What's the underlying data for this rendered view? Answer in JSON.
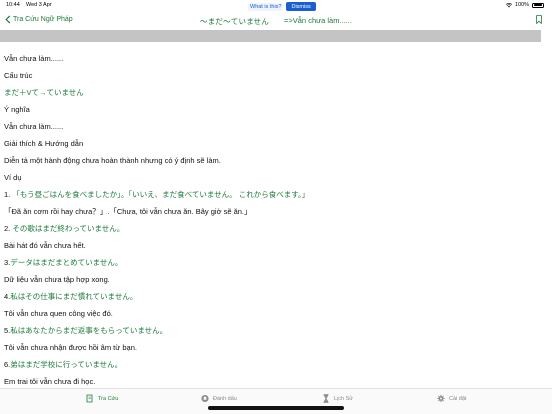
{
  "status": {
    "time": "10:44",
    "date": "Wed 3 Apr",
    "battery": "100%"
  },
  "banner": {
    "question": "What is this?",
    "dismiss": "Dismiss"
  },
  "nav": {
    "back_label": "Tra Cứu Ngữ Pháp",
    "title": "～まだ～ていません",
    "subtitle": "=>Vẫn chưa làm......",
    "accent_color": "#1a7a3a"
  },
  "content": {
    "lines": [
      {
        "text": "Vẫn chưa làm......",
        "green": false
      },
      {
        "text": "Cấu trúc",
        "green": false
      },
      {
        "text": "まだ＋Vて→ていません",
        "green": true
      },
      {
        "text": "Ý nghĩa",
        "green": false
      },
      {
        "text": "Vẫn chưa làm......",
        "green": false
      },
      {
        "text": "Giải thích & Hướng dẫn",
        "green": false
      },
      {
        "text": "Diễn tả một hành động chưa hoàn thành nhưng có ý định sẽ làm.",
        "green": false
      },
      {
        "text": "Ví dụ",
        "green": false
      },
      {
        "prefix": "1.",
        "text": "「もう昼ごはんを食べましたか」。「いいえ、まだ食べていません。 これから食べます。」",
        "green": true
      },
      {
        "text": "「Đã ăn cơm rồi hay chưa？」.「Chưa, tôi vẫn chưa ăn. Bây giờ sẽ ăn.」",
        "green": false
      },
      {
        "prefix": "2.",
        "text": "その歌はまだ終わっていません。",
        "green": true
      },
      {
        "text": " Bài hát đó vẫn chưa hết.",
        "green": false
      },
      {
        "prefix": "3.",
        "text": "データはまだまとめていません。",
        "green": true
      },
      {
        "text": "Dữ liệu vẫn chưa tập hợp xong.",
        "green": false
      },
      {
        "prefix": "4.",
        "text": "私はその仕事にまだ慣れていません。",
        "green": true
      },
      {
        "text": "Tôi vẫn chưa quen công việc đó.",
        "green": false
      },
      {
        "prefix": "5.",
        "text": "私はあなたからまだ返事をもらっていません。",
        "green": true
      },
      {
        "text": "Tôi vẫn chưa nhận được hồi âm từ bạn.",
        "green": false
      },
      {
        "prefix": "6.",
        "text": "弟はまだ学校に行っていません。",
        "green": true
      },
      {
        "text": "Em trai tôi vẫn chưa đi học.",
        "green": false
      }
    ]
  },
  "tabs": [
    {
      "label": "Tra Cứu",
      "icon": "book-icon",
      "active": true
    },
    {
      "label": "Đánh dấu",
      "icon": "bookmark-circle-icon",
      "active": false
    },
    {
      "label": "Lịch Sử",
      "icon": "hourglass-icon",
      "active": false
    },
    {
      "label": "Cài đặt",
      "icon": "gear-icon",
      "active": false
    }
  ]
}
